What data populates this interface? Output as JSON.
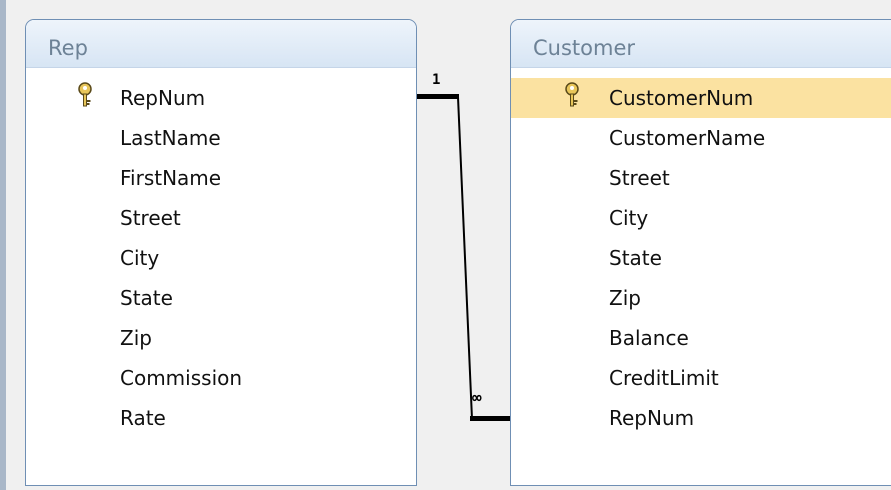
{
  "rep_table": {
    "title": "Rep",
    "fields": [
      "RepNum",
      "LastName",
      "FirstName",
      "Street",
      "City",
      "State",
      "Zip",
      "Commission",
      "Rate"
    ],
    "primary_key": "RepNum"
  },
  "customer_table": {
    "title": "Customer",
    "fields": [
      "CustomerNum",
      "CustomerName",
      "Street",
      "City",
      "State",
      "Zip",
      "Balance",
      "CreditLimit",
      "RepNum"
    ],
    "primary_key": "CustomerNum",
    "selected_field": "CustomerNum"
  },
  "relationship": {
    "one_side_label": "1",
    "many_side_label": "∞"
  },
  "colors": {
    "title_text": "#6d8296",
    "border": "#6f8fb4",
    "selected_row": "#fbe2a1"
  },
  "icons": {
    "primary_key": "key-icon"
  }
}
